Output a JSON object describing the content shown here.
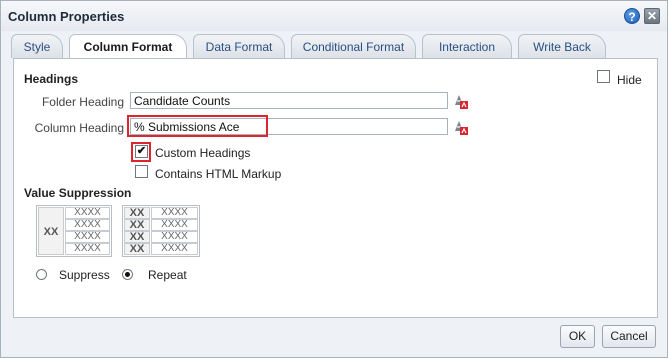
{
  "dialog": {
    "title": "Column Properties",
    "help_glyph": "?",
    "close_glyph": "✕"
  },
  "tabs": [
    {
      "label": "Style",
      "active": false
    },
    {
      "label": "Column Format",
      "active": true
    },
    {
      "label": "Data Format",
      "active": false
    },
    {
      "label": "Conditional Format",
      "active": false
    },
    {
      "label": "Interaction",
      "active": false
    },
    {
      "label": "Write Back",
      "active": false
    }
  ],
  "headings": {
    "section_title": "Headings",
    "hide_label": "Hide",
    "hide_checked": false,
    "folder_heading_label": "Folder Heading",
    "folder_heading_value": "Candidate Counts",
    "column_heading_label": "Column Heading",
    "column_heading_value": "% Submissions Ace",
    "custom_headings_label": "Custom Headings",
    "custom_headings_checked": true,
    "custom_headings_mark": "✔",
    "contains_html_label": "Contains HTML Markup",
    "contains_html_checked": false
  },
  "value_suppression": {
    "section_title": "Value Suppression",
    "sample_suppress": {
      "head": "XX",
      "cells": [
        "XXXX",
        "XXXX",
        "XXXX",
        "XXXX"
      ]
    },
    "sample_repeat": {
      "heads": [
        "XX",
        "XX",
        "XX",
        "XX"
      ],
      "cells": [
        "XXXX",
        "XXXX",
        "XXXX",
        "XXXX"
      ]
    },
    "options": [
      {
        "label": "Suppress",
        "selected": false
      },
      {
        "label": "Repeat",
        "selected": true
      }
    ]
  },
  "footer": {
    "ok_label": "OK",
    "cancel_label": "Cancel"
  },
  "colors": {
    "highlight": "#d9262f",
    "tab_text": "#2b4f80",
    "help_button": "#1b5fb8"
  },
  "icons": {
    "help": "help-icon",
    "close": "close-icon",
    "edit_heading": "edit-text-icon"
  }
}
